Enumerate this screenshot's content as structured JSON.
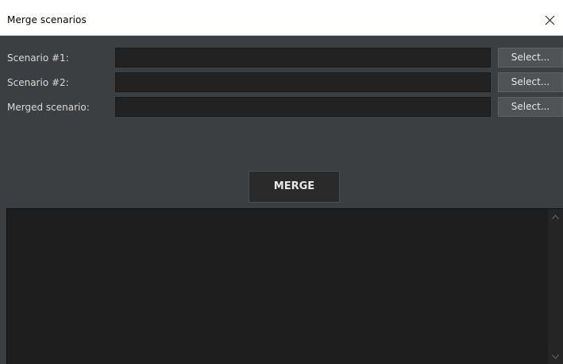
{
  "window": {
    "title": "Merge scenarios"
  },
  "form": {
    "rows": [
      {
        "label": "Scenario #1:",
        "value": "",
        "button": "Select..."
      },
      {
        "label": "Scenario #2:",
        "value": "",
        "button": "Select..."
      },
      {
        "label": "Merged scenario:",
        "value": "",
        "button": "Select..."
      }
    ],
    "merge_label": "MERGE"
  },
  "log": {
    "text": ""
  },
  "colors": {
    "background": "#3c3f41",
    "field": "#222222",
    "log": "#1e1e1e",
    "text": "#d9d9d9"
  },
  "icons": {
    "close": "close-icon",
    "scroll_up": "chevron-up-icon",
    "scroll_down": "chevron-down-icon"
  }
}
